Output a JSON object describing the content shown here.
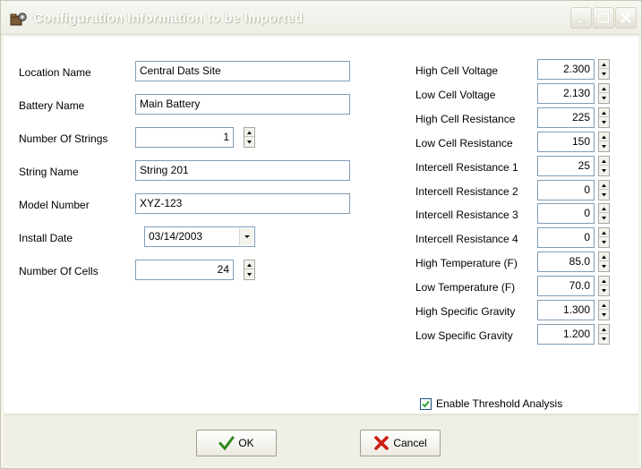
{
  "window": {
    "title": "Configuration Information to be Imported",
    "title_icon": "folder-gear-icon",
    "buttons": [
      "minimize-icon",
      "maximize-icon",
      "close-icon"
    ]
  },
  "left_form": {
    "location_name": {
      "label": "Location Name",
      "value": "Central Dats Site"
    },
    "battery_name": {
      "label": "Battery Name",
      "value": "Main Battery"
    },
    "number_of_strings": {
      "label": "Number Of Strings",
      "value": "1"
    },
    "string_name": {
      "label": "String Name",
      "value": "String 201"
    },
    "model_number": {
      "label": "Model Number",
      "value": "XYZ-123"
    },
    "install_date": {
      "label": "Install Date",
      "value": "03/14/2003"
    },
    "number_of_cells": {
      "label": "Number Of Cells",
      "value": "24"
    }
  },
  "thresholds": [
    {
      "label": "High Cell Voltage",
      "value": "2.300"
    },
    {
      "label": "Low Cell Voltage",
      "value": "2.130"
    },
    {
      "label": "High Cell Resistance",
      "value": "225"
    },
    {
      "label": "Low Cell Resistance",
      "value": "150"
    },
    {
      "label": "Intercell Resistance 1",
      "value": "25"
    },
    {
      "label": "Intercell Resistance 2",
      "value": "0"
    },
    {
      "label": "Intercell Resistance 3",
      "value": "0"
    },
    {
      "label": "Intercell Resistance 4",
      "value": "0"
    },
    {
      "label": "High Temperature (F)",
      "value": "85.0"
    },
    {
      "label": "Low Temperature (F)",
      "value": "70.0"
    },
    {
      "label": "High Specific Gravity",
      "value": "1.300"
    },
    {
      "label": "Low Specific Gravity",
      "value": "1.200"
    }
  ],
  "enable_threshold": {
    "label": "Enable Threshold Analysis",
    "checked": true
  },
  "footer": {
    "ok_label": "OK",
    "ok_icon": "checkmark-icon",
    "cancel_label": "Cancel",
    "cancel_icon": "red-x-icon"
  },
  "colors": {
    "accent_check": "#2f8a1e",
    "cancel_red": "#cc1f10"
  }
}
